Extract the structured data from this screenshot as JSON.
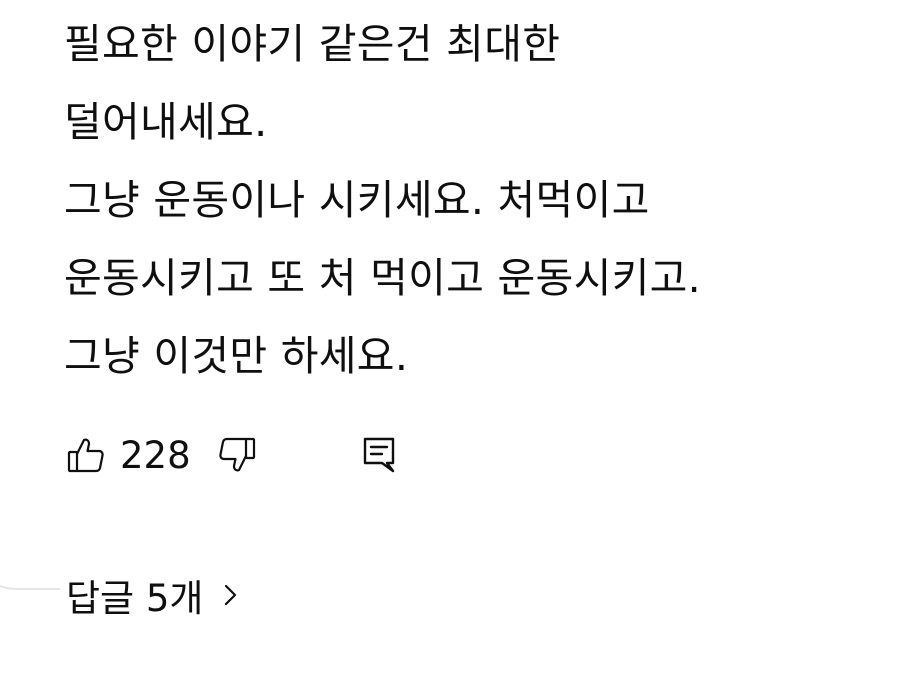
{
  "comment": {
    "lines": [
      "필요한 이야기 같은건 최대한",
      "덜어내세요.",
      "그냥 운동이나 시키세요. 처먹이고",
      "운동시키고 또 처 먹이고 운동시키고.",
      "그냥 이것만 하세요."
    ]
  },
  "actions": {
    "like_count": "228",
    "like_icon": "thumbs-up-icon",
    "dislike_icon": "thumbs-down-icon",
    "reply_icon": "comment-reply-icon"
  },
  "replies": {
    "label": "답글 5개",
    "chevron_icon": "chevron-right-icon"
  },
  "colors": {
    "text": "#0f0f0f",
    "background": "#ffffff",
    "thread_line": "#e5e5e5"
  }
}
